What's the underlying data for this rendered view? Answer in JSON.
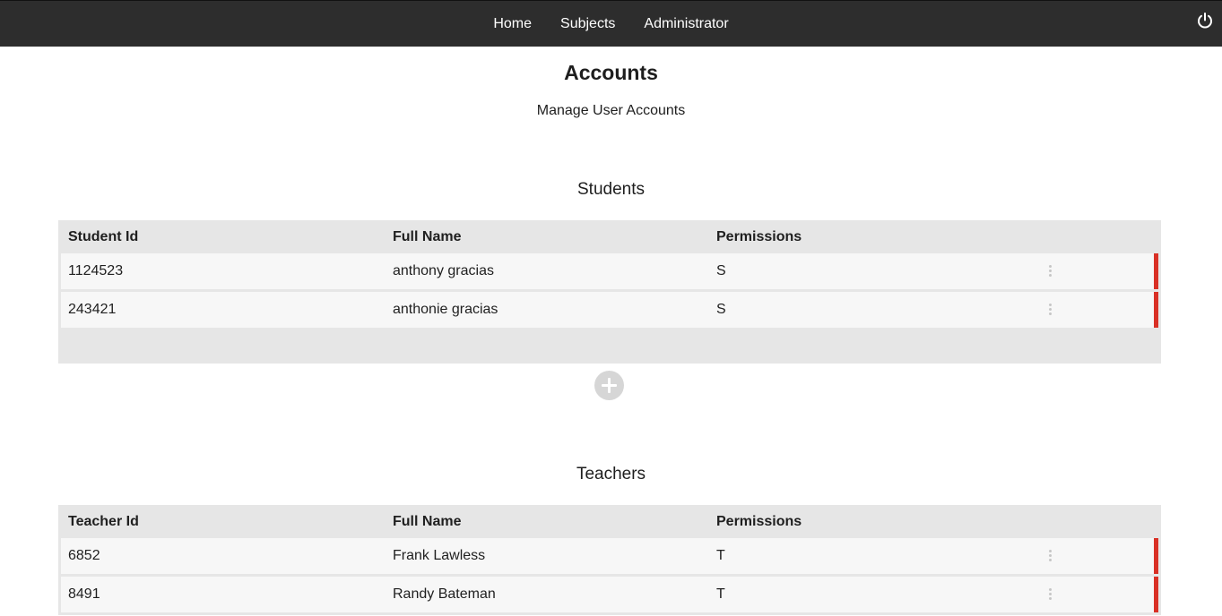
{
  "nav": {
    "items": [
      {
        "label": "Home"
      },
      {
        "label": "Subjects"
      },
      {
        "label": "Administrator"
      }
    ],
    "power_icon": "power-icon"
  },
  "page": {
    "title": "Accounts",
    "subtitle": "Manage User Accounts"
  },
  "students": {
    "title": "Students",
    "columns": [
      "Student Id",
      "Full Name",
      "Permissions"
    ],
    "rows": [
      {
        "id": "1124523",
        "name": "anthony gracias",
        "perm": "S"
      },
      {
        "id": "243421",
        "name": "anthonie gracias",
        "perm": "S"
      }
    ],
    "add_icon": "plus-circle-icon"
  },
  "teachers": {
    "title": "Teachers",
    "columns": [
      "Teacher Id",
      "Full Name",
      "Permissions"
    ],
    "rows": [
      {
        "id": "6852",
        "name": "Frank Lawless",
        "perm": "T"
      },
      {
        "id": "8491",
        "name": "Randy Bateman",
        "perm": "T"
      }
    ]
  },
  "colors": {
    "navbar": "#2d2d2d",
    "row_accent": "#d93025",
    "table_bg": "#e6e6e6",
    "row_bg": "#f7f7f7"
  }
}
